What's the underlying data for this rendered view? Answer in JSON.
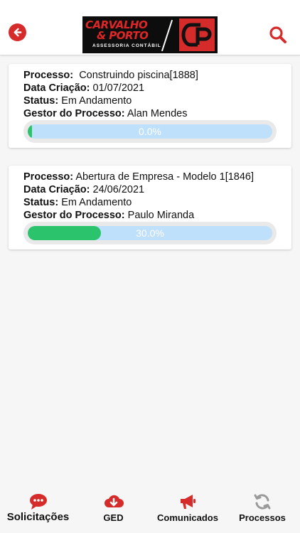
{
  "header": {
    "logo": {
      "line1": "CARVALHO",
      "line2": "& PORTO",
      "subtitle": "ASSESSORIA CONTÁBIL",
      "mark": "CP"
    },
    "back_icon": "arrow-left-icon",
    "search_icon": "search-icon"
  },
  "processes": [
    {
      "processo_label": "Processo:",
      "processo_value": "Construindo piscina[1888]",
      "data_label": "Data Criação:",
      "data_value": "01/07/2021",
      "status_label": "Status:",
      "status_value": "Em Andamento",
      "gestor_label": "Gestor do Processo:",
      "gestor_value": "Alan Mendes",
      "progress": 0.0,
      "progress_text": "0.0%"
    },
    {
      "processo_label": "Processo:",
      "processo_value": "Abertura de Empresa - Modelo 1[1846]",
      "data_label": "Data Criação:",
      "data_value": "24/06/2021",
      "status_label": "Status:",
      "status_value": "Em Andamento",
      "gestor_label": "Gestor do Processo:",
      "gestor_value": "Paulo Miranda",
      "progress": 30.0,
      "progress_text": "30.0%"
    }
  ],
  "nav": [
    {
      "label": "Solicitações",
      "icon": "chat-bubble-icon",
      "active": true
    },
    {
      "label": "GED",
      "icon": "cloud-download-icon",
      "active": false
    },
    {
      "label": "Comunicados",
      "icon": "megaphone-icon",
      "active": false
    },
    {
      "label": "Processos",
      "icon": "refresh-icon",
      "active": false
    }
  ],
  "colors": {
    "brand_red": "#d62b2b",
    "progress_fill": "#2bc36b",
    "progress_track": "#bfe0fb",
    "inactive_icon": "#9a9a9a"
  }
}
